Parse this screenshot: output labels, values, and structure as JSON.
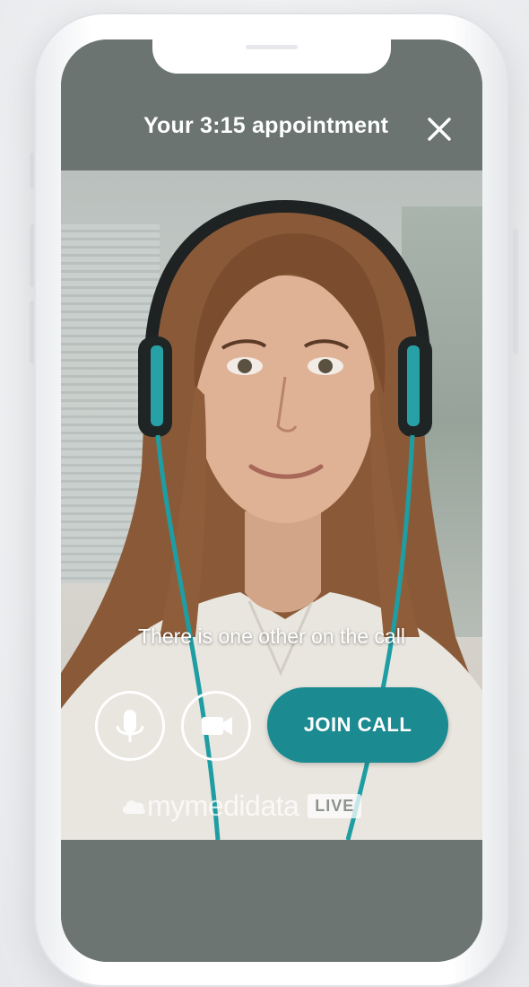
{
  "header": {
    "title": "Your 3:15 appointment",
    "close_icon": "close-icon"
  },
  "call": {
    "status_text": "There is one other on the call",
    "mic_icon": "microphone-icon",
    "camera_icon": "video-camera-icon",
    "join_label": "JOIN CALL"
  },
  "brand": {
    "logo_icon": "cloud-icon",
    "name": "mymedidata",
    "badge": "LIVE"
  },
  "colors": {
    "accent": "#1b8a91",
    "overlay_bar": "#6b7470",
    "text": "#ffffff"
  }
}
